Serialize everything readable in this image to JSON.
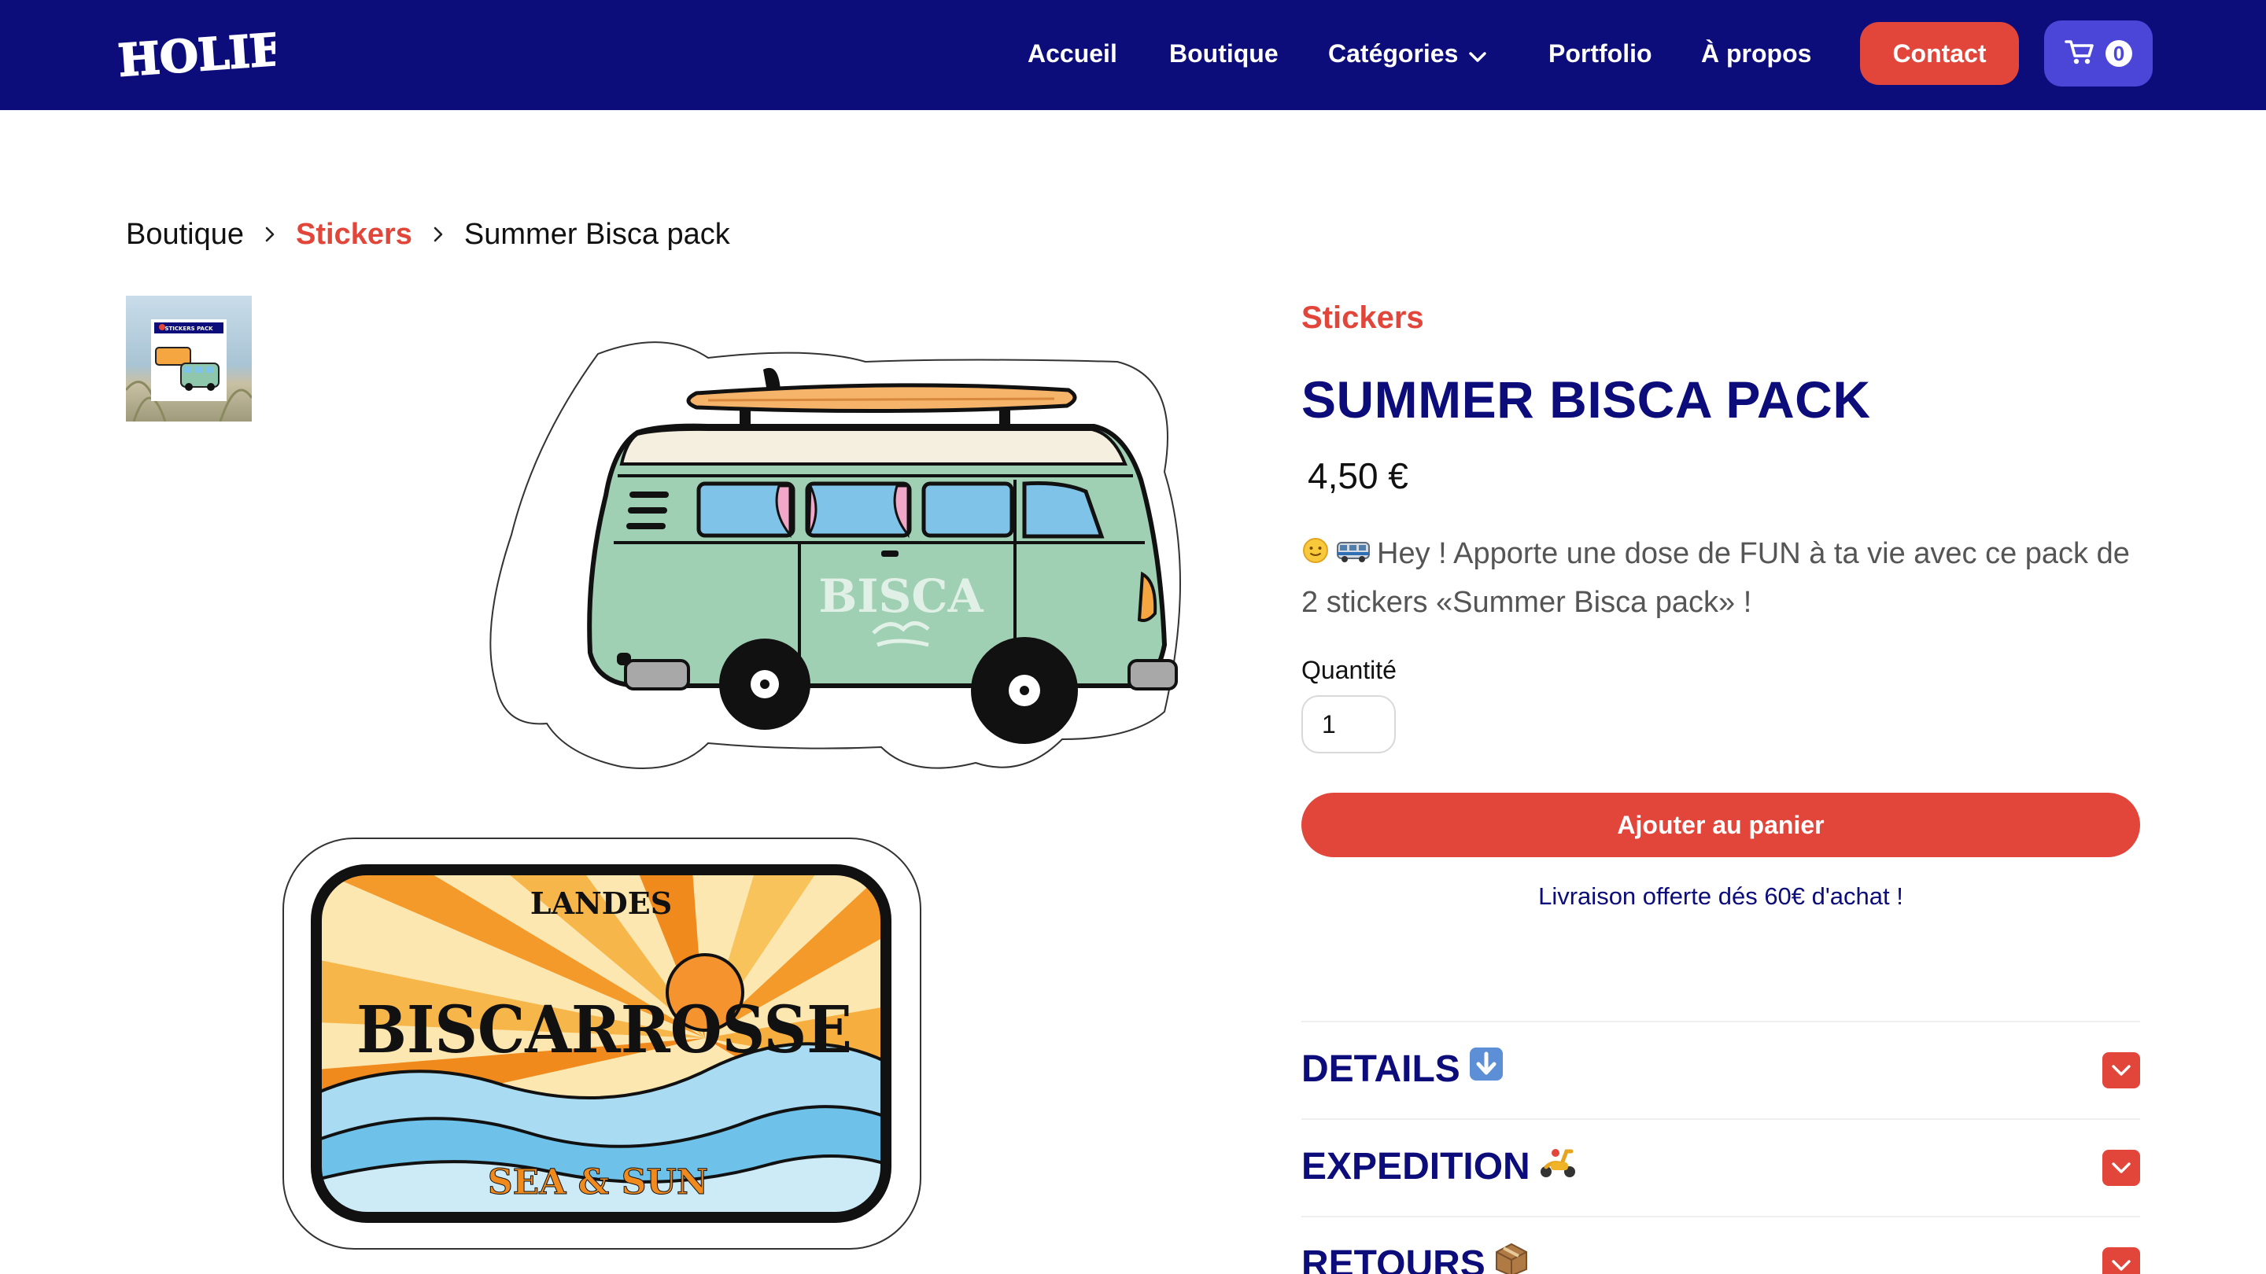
{
  "header": {
    "logo_text": "HOLIE",
    "nav": [
      {
        "label": "Accueil"
      },
      {
        "label": "Boutique"
      },
      {
        "label": "Catégories"
      },
      {
        "label": "Portfolio"
      },
      {
        "label": "À propos"
      }
    ],
    "contact_label": "Contact",
    "cart_count": "0"
  },
  "breadcrumb": {
    "items": [
      "Boutique",
      "Stickers",
      "Summer Bisca pack"
    ]
  },
  "gallery": {
    "thumbnail_text": "STICKERS PACK",
    "sticker_texts": [
      "BISCA",
      "LANDES",
      "BISCARROSSE",
      "SEA & SUN"
    ]
  },
  "product": {
    "category": "Stickers",
    "title": "SUMMER BISCA PACK",
    "price": "4,50 €",
    "description": "Hey ! Apporte une dose de FUN à ta vie avec ce pack de 2 stickers «Summer Bisca pack» !",
    "quantity_label": "Quantité",
    "quantity_value": "1",
    "add_to_cart_label": "Ajouter au panier",
    "shipping_note": "Livraison offerte dés 60€ d'achat !"
  },
  "accordion": [
    {
      "title": "DETAILS",
      "icon": "down-arrow-emoji"
    },
    {
      "title": "EXPEDITION",
      "icon": "scooter-emoji"
    },
    {
      "title": "RETOURS",
      "icon": "package-emoji"
    }
  ],
  "colors": {
    "navy": "#0c0c7a",
    "accent_red": "#e2463b",
    "cart_purple": "#4b46d8"
  }
}
